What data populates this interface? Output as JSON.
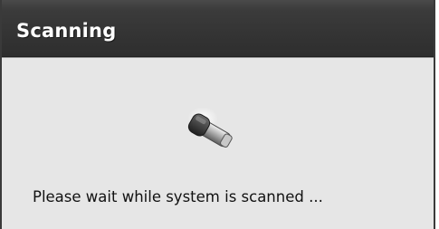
{
  "dialog": {
    "title": "Scanning",
    "status_message": "Please wait while system is scanned ...",
    "icon": "scanner-icon"
  }
}
